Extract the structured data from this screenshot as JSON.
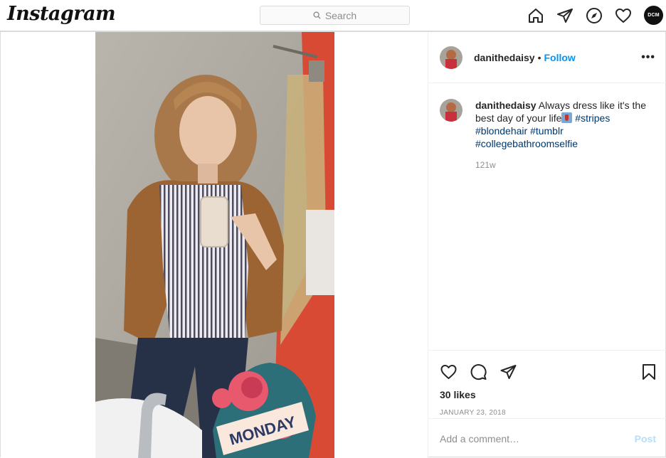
{
  "nav": {
    "logo": "Instagram",
    "search_placeholder": "Search",
    "profile_badge": "DCM",
    "icons": [
      "home-icon",
      "direct-icon",
      "explore-icon",
      "activity-heart-icon"
    ]
  },
  "post": {
    "username": "danithedaisy",
    "separator": "•",
    "follow_label": "Follow",
    "more_label": "•••",
    "caption": {
      "username": "danithedaisy",
      "text": "Always dress like it's the best day of your life",
      "hashtags": [
        "#stripes",
        "#blondehair",
        "#tumblr",
        "#collegebathroomselfie"
      ]
    },
    "time_ago": "121w",
    "likes": "30 likes",
    "date": "JANUARY 23, 2018",
    "comment_placeholder": "Add a comment…",
    "post_label": "Post",
    "sticker_text": "MONDAY"
  },
  "colors": {
    "accent": "#0095f6",
    "link": "#00376b",
    "muted": "#8e8e8e",
    "door_red": "#d94a35"
  }
}
